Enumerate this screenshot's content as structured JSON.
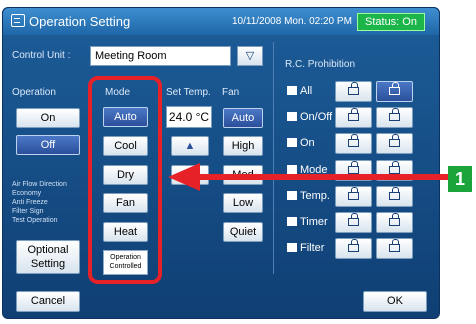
{
  "titlebar": {
    "title": "Operation Setting",
    "datetime": "10/11/2008 Mon. 02:20 PM",
    "status": "Status: On"
  },
  "control_unit": {
    "label": "Control Unit :",
    "value": "Meeting Room",
    "dropdown_glyph": "▽"
  },
  "operation": {
    "label": "Operation",
    "on": "On",
    "off": "Off"
  },
  "side_info": [
    "Air Flow Direction",
    "Economy",
    "Anti Freeze",
    "Filter Sign",
    "Test Operation"
  ],
  "optional": {
    "line1": "Optional",
    "line2": "Setting"
  },
  "mode": {
    "label": "Mode",
    "items": [
      "Auto",
      "Cool",
      "Dry",
      "Fan",
      "Heat"
    ],
    "selected": "Auto",
    "controlled_line1": "Operation",
    "controlled_line2": "Controlled"
  },
  "set_temp": {
    "label": "Set Temp.",
    "value": "24.0 °C",
    "up": "▲",
    "down": "▼"
  },
  "fan": {
    "label": "Fan",
    "items": [
      "Auto",
      "High",
      "Med",
      "Low",
      "Quiet"
    ],
    "selected": "Auto"
  },
  "rc": {
    "title": "R.C. Prohibition",
    "rows": [
      {
        "label": "All",
        "icon": "all-icon",
        "selected": 2
      },
      {
        "label": "On/Off",
        "icon": "onoff-icon",
        "selected": 0
      },
      {
        "label": "On",
        "icon": "on-icon",
        "selected": 0
      },
      {
        "label": "Mode",
        "icon": "mode-icon",
        "selected": 0
      },
      {
        "label": "Temp.",
        "icon": "temp-icon",
        "selected": 0
      },
      {
        "label": "Timer",
        "icon": "timer-icon",
        "selected": 0
      },
      {
        "label": "Filter",
        "icon": "filter-icon",
        "selected": 0
      }
    ]
  },
  "footer": {
    "cancel": "Cancel",
    "ok": "OK"
  },
  "callout": {
    "number": "1"
  },
  "colors": {
    "panel": "#0f3f74",
    "titlebar": "#2a73b9",
    "selected": "#355fae",
    "status": "#1bb54a",
    "annotation": "#e62128",
    "callout": "#1aa43a"
  }
}
